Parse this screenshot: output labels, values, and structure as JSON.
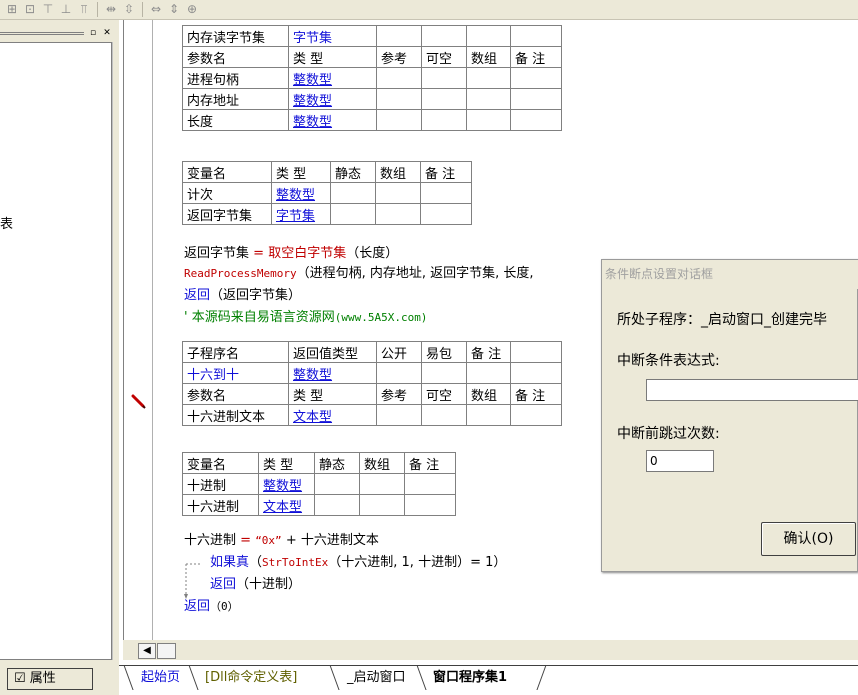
{
  "left_panel": {
    "item_text": "表"
  },
  "dll_table": {
    "header": [
      "内存读字节集",
      "字节集",
      "",
      "",
      "",
      ""
    ],
    "param_header": [
      "参数名",
      "类 型",
      "参考",
      "可空",
      "数组",
      "备 注"
    ],
    "rows": [
      [
        "进程句柄",
        "整数型"
      ],
      [
        "内存地址",
        "整数型"
      ],
      [
        "长度",
        "整数型"
      ]
    ]
  },
  "var_table1": {
    "header": [
      "变量名",
      "类 型",
      "静态",
      "数组",
      "备 注"
    ],
    "rows": [
      [
        "计次",
        "整数型"
      ],
      [
        "返回字节集",
        "字节集"
      ]
    ]
  },
  "code1": {
    "line1_a": "返回字节集",
    "line1_b": " = ",
    "line1_c": "取空白字节集",
    "line1_d": "（长度）",
    "line2_a": "ReadProcessMemory",
    "line2_b": "（进程句柄, 内存地址, 返回字节集, 长度,",
    "line3_a": "返回",
    "line3_b": "（返回字节集）",
    "line4_a": "' 本源码来自易语言资源网",
    "line4_b": "(www.5A5X.com)"
  },
  "sub_table": {
    "header": [
      "子程序名",
      "返回值类型",
      "公开",
      "易包",
      "备 注",
      ""
    ],
    "row": [
      "十六到十",
      "整数型"
    ],
    "param_header": [
      "参数名",
      "类 型",
      "参考",
      "可空",
      "数组",
      "备 注"
    ],
    "param_row": [
      "十六进制文本",
      "文本型"
    ]
  },
  "var_table2": {
    "header": [
      "变量名",
      "类 型",
      "静态",
      "数组",
      "备 注"
    ],
    "rows": [
      [
        "十进制",
        "整数型"
      ],
      [
        "十六进制",
        "文本型"
      ]
    ]
  },
  "code2": {
    "line1_a": "十六进制",
    "line1_b": " = ",
    "line1_c": "“0x”",
    "line1_d": " + 十六进制文本",
    "line2_a": "如果真",
    "line2_b": "（",
    "line2_c": "StrToIntEx",
    "line2_d": "（十六进制, 1, 十进制）= 1）",
    "line3_a": "返回",
    "line3_b": "（十进制）",
    "line4_a": "返回",
    "line4_b": "（0）"
  },
  "dialog": {
    "title": "条件断点设置对话框",
    "sub_label": "所处子程序：_启动窗口_创建完毕",
    "cond_label": "中断条件表达式:",
    "cond_value": "",
    "skip_label": "中断前跳过次数:",
    "skip_value": "0",
    "ok_label": "确认(O)"
  },
  "tabs": [
    "起始页",
    "[Dll命令定义表]",
    "_启动窗口",
    "窗口程序集1"
  ],
  "property_button": "属性"
}
